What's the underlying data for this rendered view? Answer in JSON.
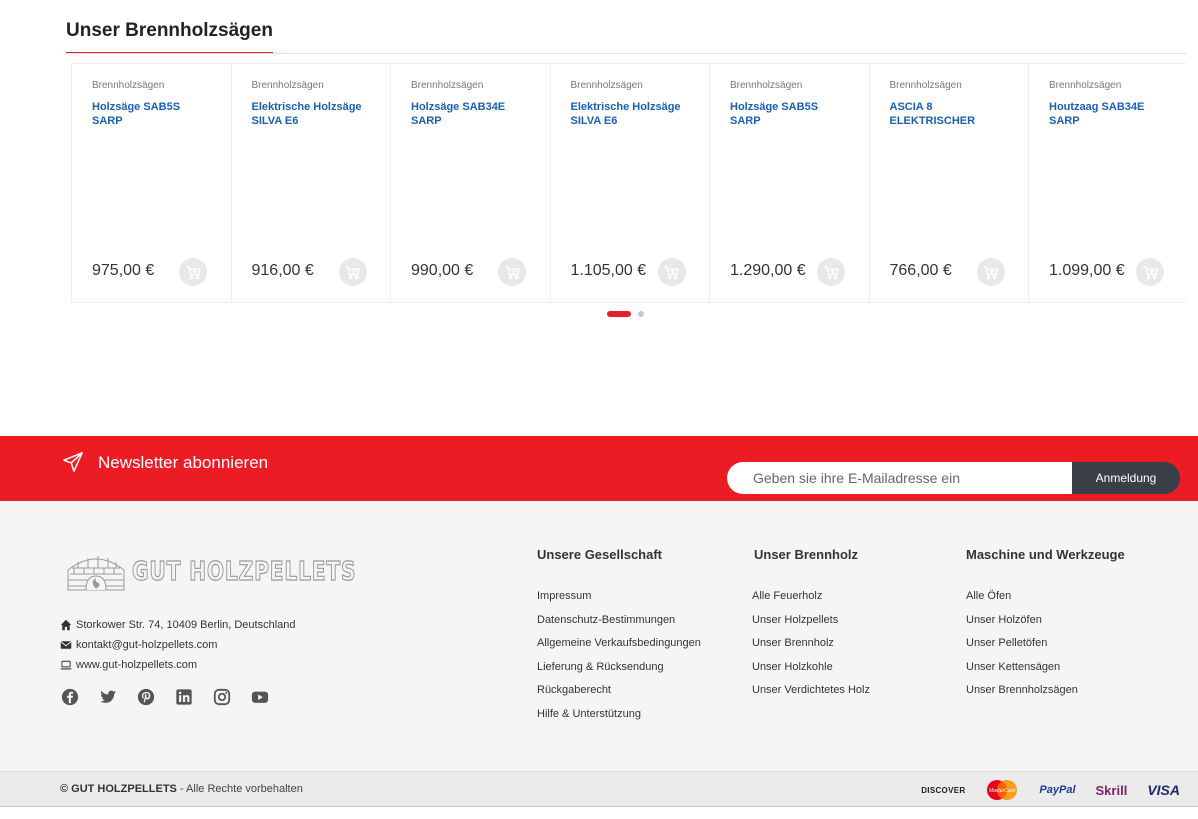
{
  "section": {
    "title": "Unser Brennholzsägen"
  },
  "products": [
    {
      "category": "Brennholzsägen",
      "title": "Holzsäge SAB5S SARP",
      "price": "975,00 €"
    },
    {
      "category": "Brennholzsägen",
      "title": "Elektrische Holzsäge SILVA E6",
      "price": "916,00 €"
    },
    {
      "category": "Brennholzsägen",
      "title": "Holzsäge SAB34E SARP",
      "price": "990,00 €"
    },
    {
      "category": "Brennholzsägen",
      "title": "Elektrische Holzsäge SILVA E6",
      "price": "1.105,00 €"
    },
    {
      "category": "Brennholzsägen",
      "title": "Holzsäge SAB5S SARP",
      "price": "1.290,00 €"
    },
    {
      "category": "Brennholzsägen",
      "title": "ASCIA 8 ELEKTRISCHER",
      "price": "766,00 €"
    },
    {
      "category": "Brennholzsägen",
      "title": "Houtzaag SAB34E SARP",
      "price": "1.099,00 €"
    }
  ],
  "carousel": {
    "active_page": 1,
    "pages": 2
  },
  "newsletter": {
    "title": "Newsletter abonnieren",
    "placeholder": "Geben sie ihre E-Mailadresse ein",
    "button": "Anmeldung"
  },
  "footer": {
    "logo_text": "GUT HOLZPELLETS",
    "address": "Storkower Str. 74, 10409 Berlin, Deutschland",
    "email": "kontakt@gut-holzpellets.com",
    "website": "www.gut-holzpellets.com",
    "socials": [
      "facebook-icon",
      "twitter-icon",
      "pinterest-icon",
      "linkedin-icon",
      "instagram-icon",
      "youtube-icon"
    ],
    "columns": [
      {
        "title": "Unsere Gesellschaft",
        "links": [
          "Impressum",
          "Datenschutz-Bestimmungen",
          "Allgemeine Verkaufsbedingungen",
          "Lieferung & Rücksendung",
          "Rückgaberecht",
          "Hilfe & Unterstützung"
        ]
      },
      {
        "title": "Unser Brennholz",
        "links": [
          "Alle Feuerholz",
          "Unser Holzpellets",
          "Unser Brennholz",
          "Unser Holzkohle",
          "Unser Verdichtetes Holz"
        ]
      },
      {
        "title": "Maschine und Werkzeuge",
        "links": [
          "Alle Öfen",
          "Unser Holzöfen",
          "Unser Pelletöfen",
          "Unser Kettensägen",
          "Unser Brennholzsägen"
        ]
      }
    ]
  },
  "bottom": {
    "copyright_brand": "© GUT HOLZPELLETS",
    "copyright_rest": " - Alle Rechte vorbehalten",
    "payments": [
      "DISCOVER",
      "MasterCard",
      "PayPal",
      "Skrill",
      "VISA"
    ]
  },
  "colors": {
    "accent": "#ec1c24",
    "link": "#1a5fb4",
    "button_dark": "#3a3f47",
    "footer_bg": "#f5f5f5"
  }
}
